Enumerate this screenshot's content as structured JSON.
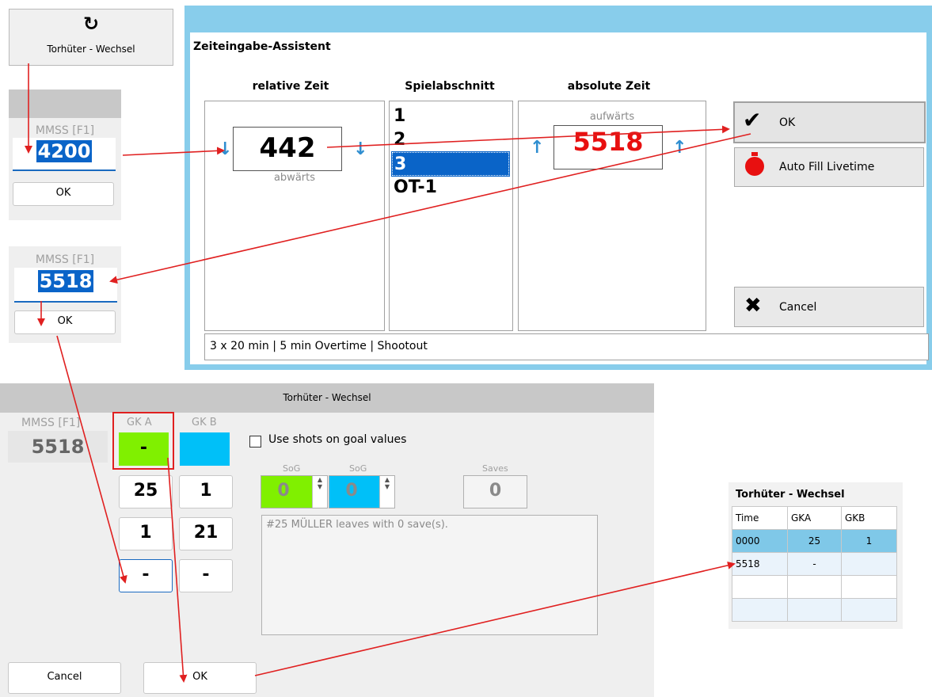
{
  "gk_change_button": {
    "icon": "refresh-icon",
    "label": "Torhüter - Wechsel"
  },
  "time_popup_1": {
    "caption": "MMSS [F1]",
    "value": "4200",
    "ok_label": "OK"
  },
  "time_popup_2": {
    "caption": "MMSS [F1]",
    "value": "5518",
    "ok_label": "OK"
  },
  "assistant": {
    "title": "Zeiteingabe-Assistent",
    "relative": {
      "header": "relative Zeit",
      "value": "442",
      "direction": "abwärts"
    },
    "period": {
      "header": "Spielabschnitt",
      "items": [
        "1",
        "2",
        "3",
        "OT-1"
      ],
      "selected": "3"
    },
    "absolute": {
      "header": "absolute Zeit",
      "direction": "aufwärts",
      "value": "5518",
      "value_color": "#e81010"
    },
    "ok_label": "OK",
    "autofill_label": "Auto Fill Livetime",
    "cancel_label": "Cancel",
    "footer": "3 x 20 min | 5 min Overtime | Shootout",
    "border_color": "#88cdeb"
  },
  "gk_dialog": {
    "title": "Torhüter - Wechsel",
    "time_caption": "MMSS [F1]",
    "time_value": "5518",
    "gk_a": {
      "label": "GK A",
      "current": "-",
      "color": "#80f000"
    },
    "gk_b": {
      "label": "GK B",
      "current": "",
      "color": "#00c0f8"
    },
    "column_a_buttons": [
      "25",
      "1",
      "-"
    ],
    "column_b_buttons": [
      "1",
      "21",
      "-"
    ],
    "use_sog_label": "Use shots on goal values",
    "use_sog_checked": false,
    "sog_a": {
      "label": "SoG",
      "value": "0"
    },
    "sog_b": {
      "label": "SoG",
      "value": "0"
    },
    "saves": {
      "label": "Saves",
      "value": "0"
    },
    "message": "#25 MÜLLER leaves with 0 save(s).",
    "cancel_label": "Cancel",
    "ok_label": "OK"
  },
  "result_table": {
    "title": "Torhüter - Wechsel",
    "headers": [
      "Time",
      "GKA",
      "GKB"
    ],
    "rows": [
      [
        "0000",
        "25",
        "1"
      ],
      [
        "5518",
        "-",
        ""
      ],
      [
        "",
        "",
        ""
      ],
      [
        "",
        "",
        ""
      ]
    ]
  },
  "annotation_color": "#e02020"
}
